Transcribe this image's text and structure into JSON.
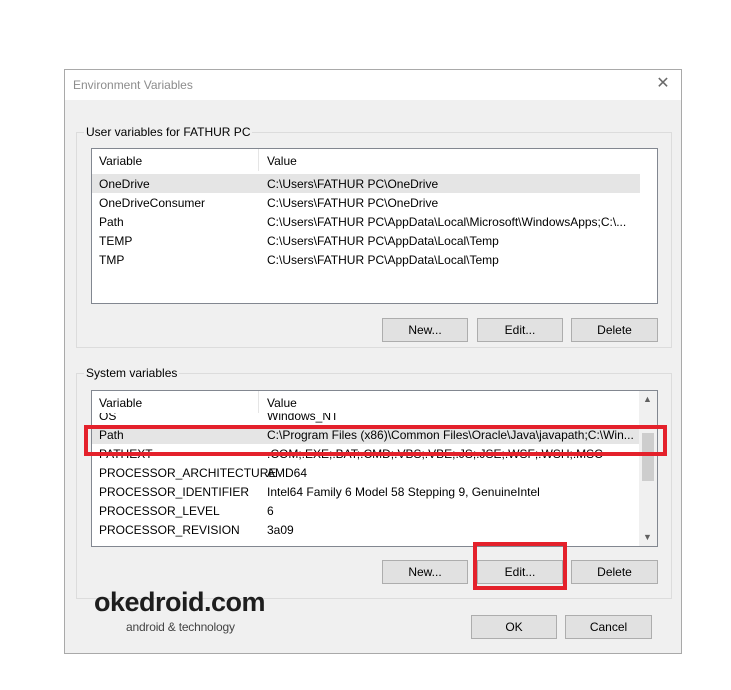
{
  "window": {
    "title": "Environment Variables",
    "close_glyph": "✕"
  },
  "user_vars": {
    "group_label": "User variables for FATHUR PC",
    "header": {
      "variable": "Variable",
      "value": "Value"
    },
    "rows": [
      {
        "variable": "OneDrive",
        "value": "C:\\Users\\FATHUR PC\\OneDrive"
      },
      {
        "variable": "OneDriveConsumer",
        "value": "C:\\Users\\FATHUR PC\\OneDrive"
      },
      {
        "variable": "Path",
        "value": "C:\\Users\\FATHUR PC\\AppData\\Local\\Microsoft\\WindowsApps;C:\\..."
      },
      {
        "variable": "TEMP",
        "value": "C:\\Users\\FATHUR PC\\AppData\\Local\\Temp"
      },
      {
        "variable": "TMP",
        "value": "C:\\Users\\FATHUR PC\\AppData\\Local\\Temp"
      }
    ],
    "buttons": {
      "new": "New...",
      "edit": "Edit...",
      "delete": "Delete"
    }
  },
  "system_vars": {
    "group_label": "System variables",
    "header": {
      "variable": "Variable",
      "value": "Value"
    },
    "rows": [
      {
        "variable": "OS",
        "value": "Windows_NT"
      },
      {
        "variable": "Path",
        "value": "C:\\Program Files (x86)\\Common Files\\Oracle\\Java\\javapath;C:\\Win..."
      },
      {
        "variable": "PATHEXT",
        "value": ".COM;.EXE;.BAT;.CMD;.VBS;.VBE;.JS;.JSE;.WSF;.WSH;.MSC"
      },
      {
        "variable": "PROCESSOR_ARCHITECTURE",
        "value": "AMD64"
      },
      {
        "variable": "PROCESSOR_IDENTIFIER",
        "value": "Intel64 Family 6 Model 58 Stepping 9, GenuineIntel"
      },
      {
        "variable": "PROCESSOR_LEVEL",
        "value": "6"
      },
      {
        "variable": "PROCESSOR_REVISION",
        "value": "3a09"
      }
    ],
    "buttons": {
      "new": "New...",
      "edit": "Edit...",
      "delete": "Delete"
    }
  },
  "footer": {
    "ok": "OK",
    "cancel": "Cancel"
  },
  "watermark": {
    "brand": "okedroid.com",
    "tagline": "android & technology"
  },
  "colors": {
    "highlight": "#e4212b",
    "selected_row": "#e5e5e5"
  }
}
